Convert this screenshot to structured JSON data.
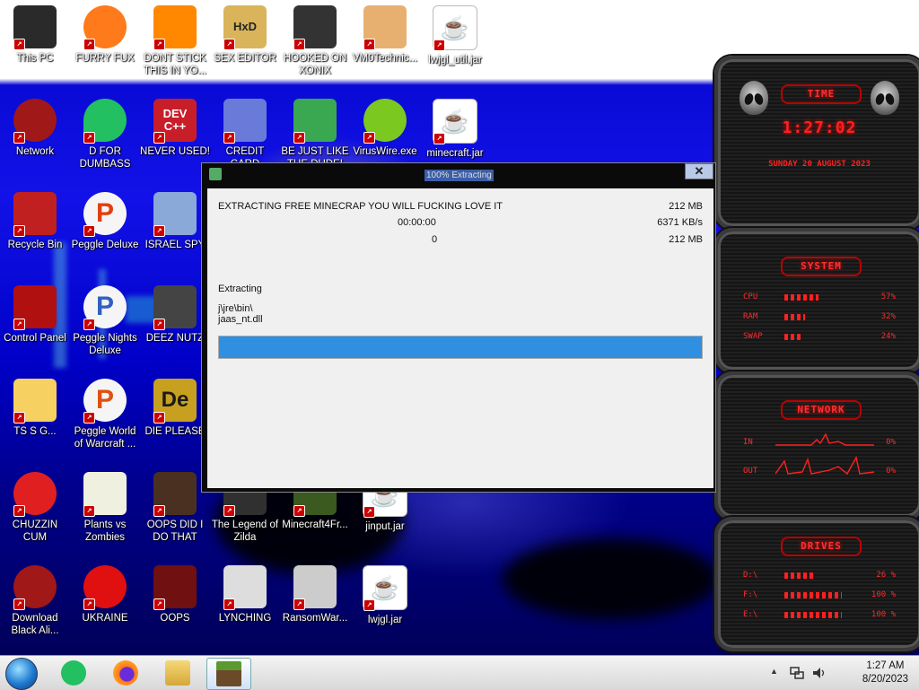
{
  "desktop_icons": [
    {
      "label": "This PC",
      "icon": "computer-icon",
      "color": "#2a2a2a"
    },
    {
      "label": "FURRY FUX",
      "icon": "firefox-icon",
      "color": "#ff7a1a"
    },
    {
      "label": "DONT STICK THIS IN YO...",
      "icon": "vlc-cone-icon",
      "color": "#ff8800"
    },
    {
      "label": "SEX EDITOR",
      "icon": "hxd-editor-icon",
      "color": "#d9b45a"
    },
    {
      "label": "HOOKED ON XONIX",
      "icon": "maze-game-icon",
      "color": "#333333"
    },
    {
      "label": "VM0Technic...",
      "icon": "doctor-icon",
      "color": "#e8b070"
    },
    {
      "label": "lwjgl_util.jar",
      "icon": "java-jar-icon",
      "color": "#ffffff"
    },
    {
      "label": "Network",
      "icon": "network-orb-icon",
      "color": "#a01818"
    },
    {
      "label": "D FOR DUMBASS",
      "icon": "chat-bubble-icon",
      "color": "#22c060"
    },
    {
      "label": "NEVER USED!",
      "icon": "devcpp-icon",
      "color": "#c81e2a"
    },
    {
      "label": "CREDIT CARD CHECKER",
      "icon": "credit-card-icon",
      "color": "#6a7ad8"
    },
    {
      "label": "BE JUST LIKE THE DUDE!",
      "icon": "dude-face-icon",
      "color": "#3aa850"
    },
    {
      "label": "VirusWire.exe",
      "icon": "lime-icon",
      "color": "#7ac820"
    },
    {
      "label": "minecraft.jar",
      "icon": "java-jar-icon",
      "color": "#ffffff"
    },
    {
      "label": "Recycle Bin",
      "icon": "recycle-bin-icon",
      "color": "#c02020"
    },
    {
      "label": "Peggle Deluxe",
      "icon": "peggle-icon",
      "color": "#e04010"
    },
    {
      "label": "ISRAEL SPY",
      "icon": "remote-desktop-icon",
      "color": "#8aa8d8"
    },
    {
      "label": "Control Panel",
      "icon": "control-panel-icon",
      "color": "#b01010"
    },
    {
      "label": "Peggle Nights Deluxe",
      "icon": "peggle-nights-icon",
      "color": "#3060c0"
    },
    {
      "label": "DEEZ NUTZ",
      "icon": "windows-stack-icon",
      "color": "#444444"
    },
    {
      "label": "TS S G...",
      "icon": "cartoon-girl-icon",
      "color": "#f6d060"
    },
    {
      "label": "Peggle World of Warcraft ...",
      "icon": "peggle-wow-icon",
      "color": "#e05010"
    },
    {
      "label": "DIE PLEASE",
      "icon": "de-logo-icon",
      "color": "#c8a020"
    },
    {
      "label": "CHUZZIN CUM",
      "icon": "chuzzle-icon",
      "color": "#e02020"
    },
    {
      "label": "Plants vs Zombies",
      "icon": "flower-icon",
      "color": "#f0f0e0"
    },
    {
      "label": "OOPS DID I DO THAT",
      "icon": "portrait-icon",
      "color": "#4a3020"
    },
    {
      "label": "The Legend of Zilda",
      "icon": "zelda-icon",
      "color": "#303030"
    },
    {
      "label": "Minecraft4Fr...",
      "icon": "grass-block-icon",
      "color": "#3a5a20"
    },
    {
      "label": "jinput.jar",
      "icon": "java-jar-icon",
      "color": "#ffffff"
    },
    {
      "label": "Download Black Ali...",
      "icon": "alien-orb-icon",
      "color": "#a01818"
    },
    {
      "label": "UKRAINE",
      "icon": "radiation-icon",
      "color": "#e01010"
    },
    {
      "label": "OOPS",
      "icon": "oops-app-icon",
      "color": "#701010"
    },
    {
      "label": "LYNCHING",
      "icon": "noose-icon",
      "color": "#dddddd"
    },
    {
      "label": "RansomWar...",
      "icon": "skull-ring-icon",
      "color": "#cccccc"
    },
    {
      "label": "lwjgl.jar",
      "icon": "java-jar-icon",
      "color": "#ffffff"
    }
  ],
  "icon_texts": {
    "dev": "DEV",
    "dev_sub": "C++",
    "hxd": "HxD",
    "de": "De",
    "p": "P"
  },
  "dialog": {
    "title": "100% Extracting",
    "close_glyph": "✕",
    "archive_name": "EXTRACTING FREE MINECRAP YOU WILL FUCKING LOVE IT",
    "total_size": "212 MB",
    "elapsed": "00:00:00",
    "speed": "6371 KB/s",
    "count": "0",
    "processed": "212 MB",
    "status": "Extracting",
    "path_line1": "j\\jre\\bin\\",
    "path_line2": "jaas_nt.dll",
    "progress_percent": 100
  },
  "widgets": {
    "time": {
      "title": "TIME",
      "clock": "1:27:02",
      "date": "SUNDAY 20 AUGUST 2023"
    },
    "system": {
      "title": "SYSTEM",
      "rows": [
        {
          "label": "CPU",
          "value": "57%",
          "fill": 0.57
        },
        {
          "label": "RAM",
          "value": "32%",
          "fill": 0.32
        },
        {
          "label": "SWAP",
          "value": "24%",
          "fill": 0.24
        }
      ]
    },
    "network": {
      "title": "NETWORK",
      "rows": [
        {
          "label": "IN",
          "value": "0%"
        },
        {
          "label": "OUT",
          "value": "0%"
        }
      ]
    },
    "drives": {
      "title": "DRIVES",
      "rows": [
        {
          "label": "D:\\",
          "value": "26 %",
          "fill": 0.26
        },
        {
          "label": "F:\\",
          "value": "100 %",
          "fill": 1.0
        },
        {
          "label": "E:\\",
          "value": "100 %",
          "fill": 1.0
        }
      ]
    }
  },
  "taskbar": {
    "pinned": [
      {
        "name": "start-orb",
        "icon": "windows-orb-icon"
      },
      {
        "name": "taskbar-chat",
        "icon": "chat-bubble-icon",
        "color": "#22c060"
      },
      {
        "name": "taskbar-firefox",
        "icon": "firefox-icon",
        "color": "#ff7a1a"
      },
      {
        "name": "taskbar-explorer",
        "icon": "folder-icon",
        "color": "#e8c050"
      },
      {
        "name": "taskbar-minecraft",
        "icon": "grass-block-icon",
        "color": "#3a5a20"
      }
    ],
    "tray_arrow": "▲",
    "time": "1:27 AM",
    "date": "8/20/2023"
  }
}
